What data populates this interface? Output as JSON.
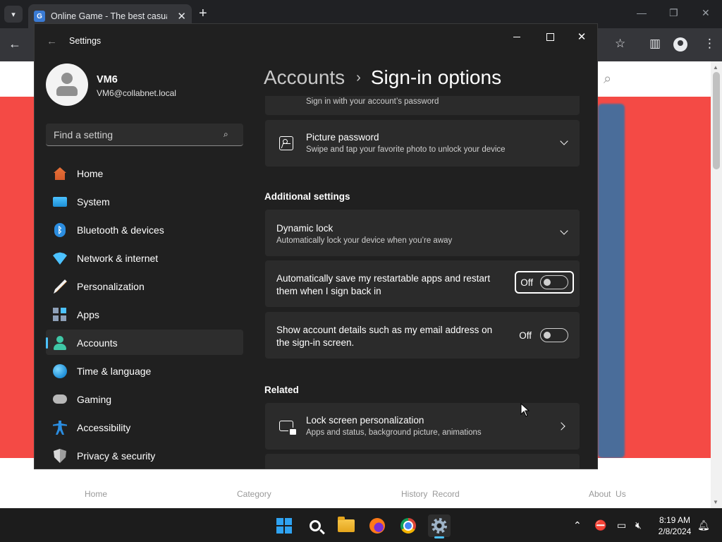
{
  "browser": {
    "tab_title": "Online Game - The best casual",
    "tab_close": "✕",
    "new_tab": "+",
    "favicon_letter": "G",
    "nav_back": "←",
    "page_nav": [
      {
        "label": "Home"
      },
      {
        "label": "Category"
      },
      {
        "label": "History  Record"
      },
      {
        "label": "About  Us"
      }
    ]
  },
  "settings_window": {
    "title": "Settings",
    "back_icon": "←",
    "close_icon": "✕",
    "profile": {
      "name": "VM6",
      "email": "VM6@collabnet.local"
    },
    "search": {
      "placeholder": "Find a setting",
      "icon": "⌕"
    },
    "nav": [
      {
        "label": "Home",
        "icon": "home-icon"
      },
      {
        "label": "System",
        "icon": "system-icon"
      },
      {
        "label": "Bluetooth & devices",
        "icon": "bluetooth-icon"
      },
      {
        "label": "Network & internet",
        "icon": "network-icon"
      },
      {
        "label": "Personalization",
        "icon": "personalization-icon"
      },
      {
        "label": "Apps",
        "icon": "apps-icon"
      },
      {
        "label": "Accounts",
        "icon": "accounts-icon",
        "active": true
      },
      {
        "label": "Time & language",
        "icon": "time-language-icon"
      },
      {
        "label": "Gaming",
        "icon": "gaming-icon"
      },
      {
        "label": "Accessibility",
        "icon": "accessibility-icon"
      },
      {
        "label": "Privacy & security",
        "icon": "privacy-icon"
      }
    ],
    "breadcrumb": {
      "parent": "Accounts",
      "separator": "›",
      "current": "Sign-in options"
    },
    "password_card": {
      "subtitle": "Sign in with your account’s password"
    },
    "picture_password": {
      "title": "Picture password",
      "subtitle": "Swipe and tap your favorite photo to unlock your device"
    },
    "additional_settings_header": "Additional settings",
    "dynamic_lock": {
      "title": "Dynamic lock",
      "subtitle": "Automatically lock your device when you’re away"
    },
    "restart_apps": {
      "text_line1": "Automatically save my restartable apps and restart",
      "text_line2": "them when I sign back in",
      "state": "Off"
    },
    "account_details": {
      "text_line1": "Show account details such as my email address on",
      "text_line2": "the sign-in screen.",
      "state": "Off"
    },
    "related_header": "Related",
    "lock_screen": {
      "title": "Lock screen personalization",
      "subtitle": "Apps and status, background picture, animations"
    }
  },
  "taskbar": {
    "clock": {
      "time": "8:19 AM",
      "date": "2/8/2024"
    },
    "tray_chevron": "⌃"
  },
  "colors": {
    "accent": "#4cc2ff",
    "window_bg": "#202020",
    "card_bg": "#2b2b2b",
    "page_red": "#f44a45"
  }
}
